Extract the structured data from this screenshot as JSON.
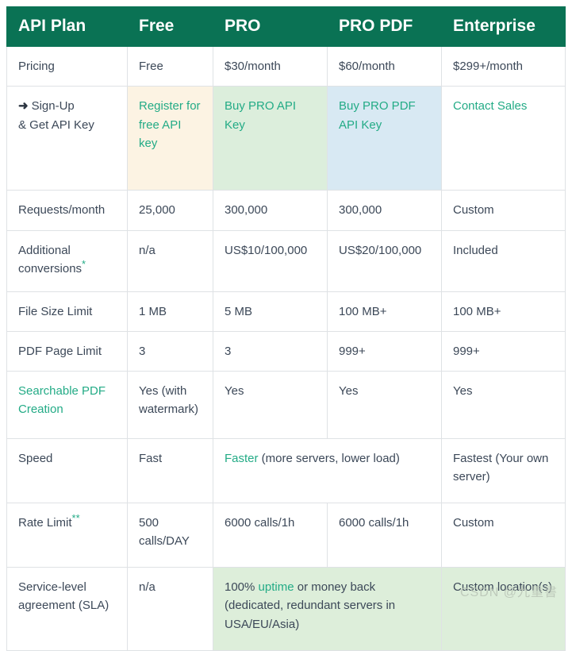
{
  "table": {
    "columns": [
      "API Plan",
      "Free",
      "PRO",
      "PRO PDF",
      "Enterprise"
    ],
    "rows": {
      "pricing": {
        "feature": "Pricing",
        "free": "Free",
        "pro": "$30/month",
        "propdf": "$60/month",
        "enterprise": "$299+/month"
      },
      "signup": {
        "arrow_icon": "➜",
        "feature_line1": "Sign-Up",
        "feature_line2": "& Get API Key",
        "free": "Register for free API key",
        "pro": "Buy PRO API Key",
        "propdf": "Buy PRO PDF API Key",
        "enterprise": "Contact Sales"
      },
      "requests": {
        "feature": "Requests/month",
        "free": "25,000",
        "pro": "300,000",
        "propdf": "300,000",
        "enterprise": "Custom"
      },
      "conversions": {
        "feature": "Additional conversions",
        "feature_marker": "*",
        "free": "n/a",
        "pro": "US$10/100,000",
        "propdf": "US$20/100,000",
        "enterprise": "Included"
      },
      "filesize": {
        "feature": "File Size Limit",
        "free": "1 MB",
        "pro": "5 MB",
        "propdf": "100 MB+",
        "enterprise": "100 MB+"
      },
      "pagelimit": {
        "feature": "PDF Page Limit",
        "free": "3",
        "pro": "3",
        "propdf": "999+",
        "enterprise": "999+"
      },
      "searchable": {
        "feature": "Searchable PDF Creation",
        "free": "Yes (with watermark)",
        "pro": "Yes",
        "propdf": "Yes",
        "enterprise": "Yes"
      },
      "speed": {
        "feature": "Speed",
        "free": "Fast",
        "pro_merged_highlight": "Faster",
        "pro_merged_rest": " (more servers, lower load)",
        "enterprise": "Fastest (Your own server)"
      },
      "ratelimit": {
        "feature": "Rate Limit",
        "feature_marker": "**",
        "free": "500 calls/DAY",
        "pro": "6000 calls/1h",
        "propdf": "6000 calls/1h",
        "enterprise": "Custom"
      },
      "sla": {
        "feature": "Service-level agreement (SLA)",
        "free": "n/a",
        "pro_merged_prefix": "100% ",
        "pro_merged_highlight": "uptime",
        "pro_merged_suffix": " or money back (dedicated, redundant servers in USA/EU/Asia)",
        "enterprise": "Custom location(s)"
      }
    }
  },
  "watermark": {
    "text": "CSDN @九重書"
  },
  "colors": {
    "header_green": "#0a7254",
    "link_teal": "#23ab86",
    "cream": "#fcf3e3",
    "light_green": "#dceedc",
    "light_blue": "#d8e9f3",
    "body_text": "#3c4858"
  }
}
